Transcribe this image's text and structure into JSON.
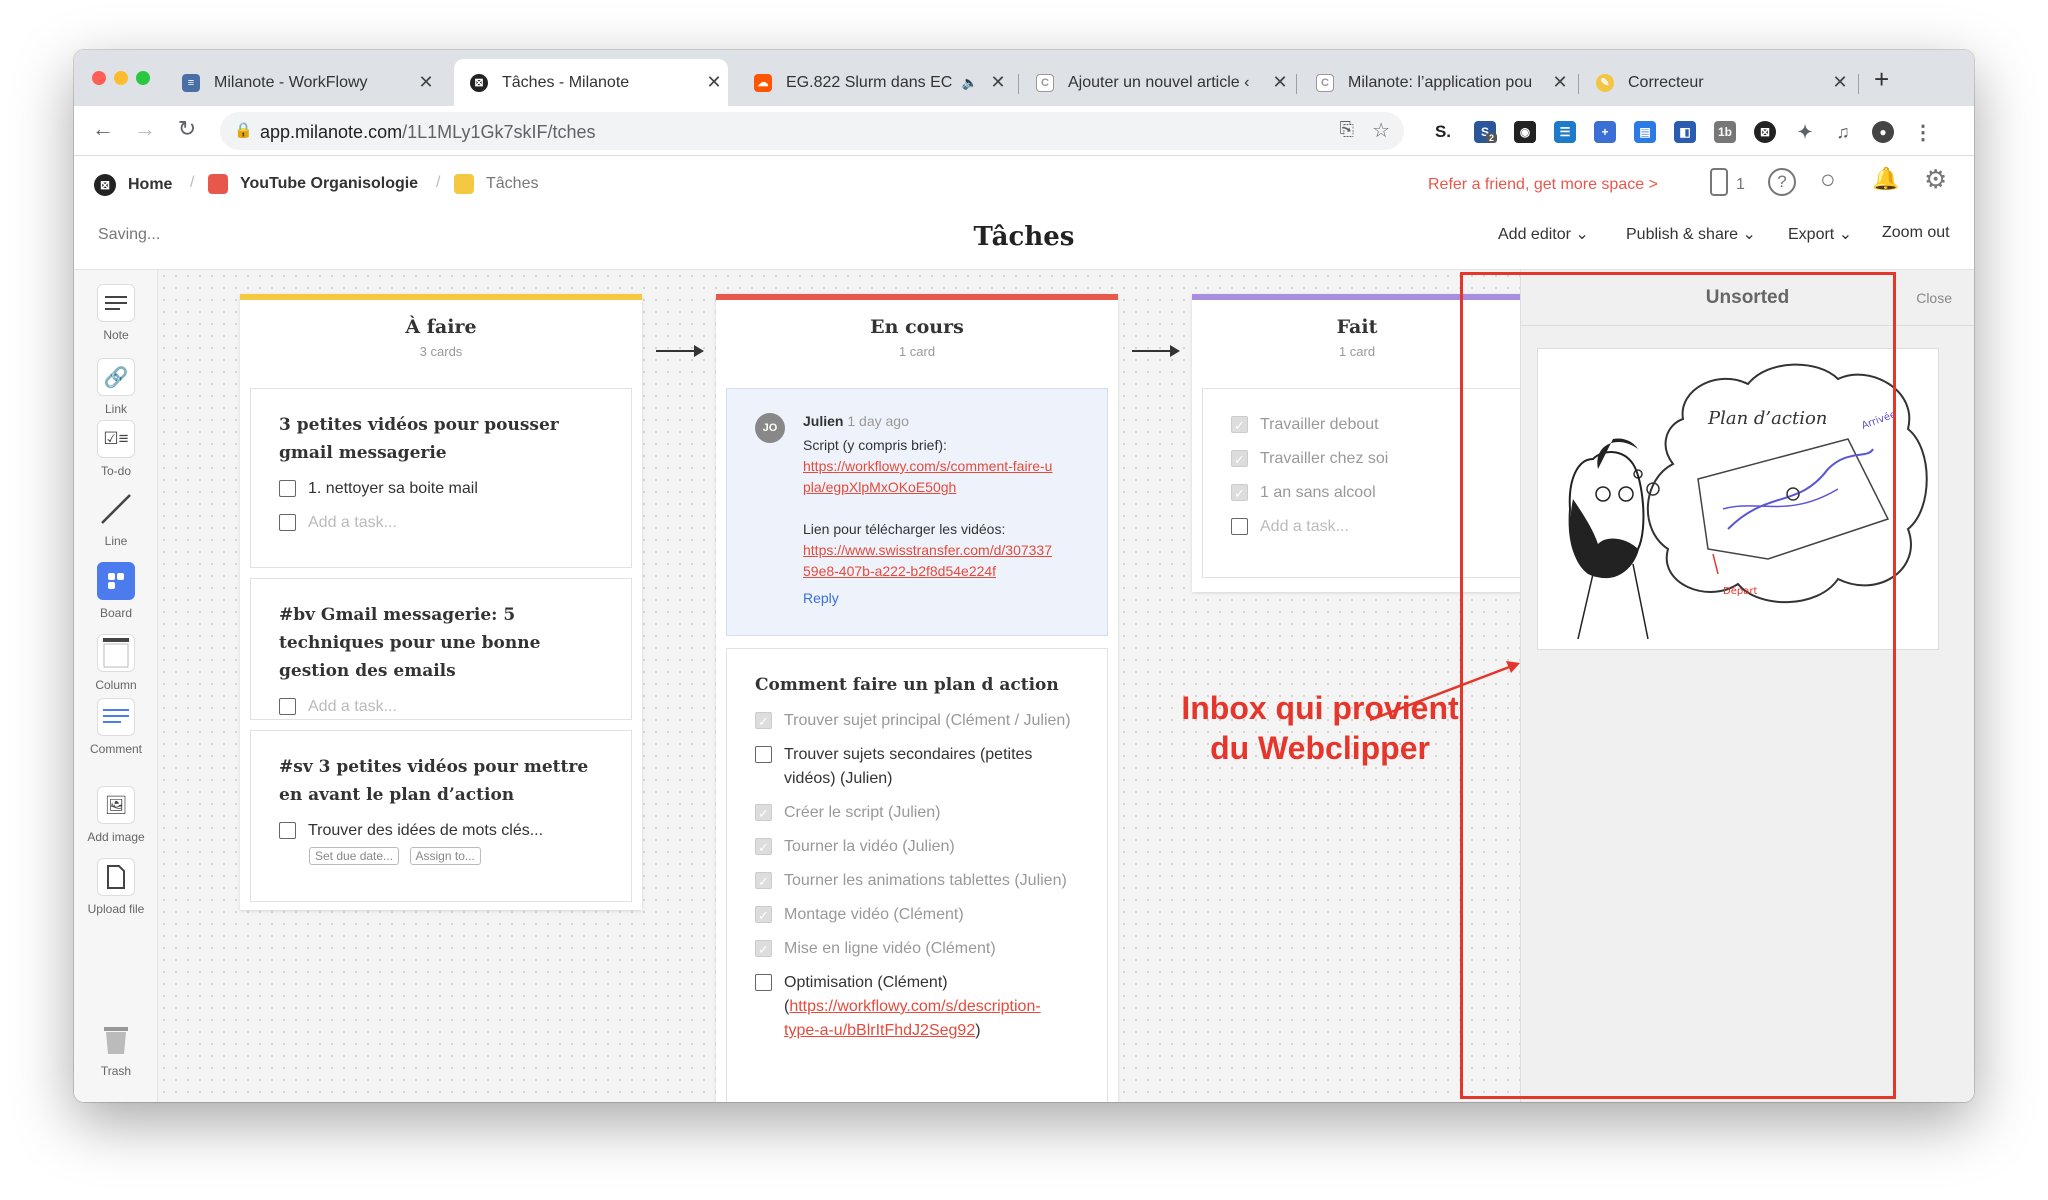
{
  "browser": {
    "tabs": [
      {
        "title": "Milanote - WorkFlowy",
        "icon": "workflowy-icon"
      },
      {
        "title": "Tâches - Milanote",
        "icon": "milanote-icon"
      },
      {
        "title": "EG.822 Slurm dans EC",
        "icon": "soundcloud-icon"
      },
      {
        "title": "Ajouter un nouvel article ‹",
        "icon": "page-icon"
      },
      {
        "title": "Milanote: l’application pou",
        "icon": "page-icon"
      },
      {
        "title": "Correcteur",
        "icon": "correcteur-icon"
      }
    ],
    "url_host": "app.milanote.com",
    "url_path": "/1L1MLy1Gk7skIF/tches",
    "new_tab": "+",
    "close": "✕",
    "ext_badge": "2"
  },
  "header": {
    "breadcrumb_home": "Home",
    "breadcrumb_board": "YouTube Organisologie",
    "breadcrumb_current": "Tâches",
    "refer": "Refer a friend, get more space >",
    "device_count": "1",
    "saving": "Saving...",
    "title": "Tâches",
    "add_editor": "Add editor",
    "publish": "Publish & share",
    "export": "Export",
    "zoom": "Zoom out"
  },
  "tools": [
    "Note",
    "Link",
    "To-do",
    "Line",
    "Board",
    "Column",
    "Comment",
    "Add image",
    "Upload file",
    "Trash"
  ],
  "columns": {
    "todo": {
      "title": "À faire",
      "count": "3 cards",
      "cards": [
        {
          "title": "3 petites vidéos pour pousser gmail messagerie",
          "task": "1. nettoyer sa boite mail",
          "add": "Add a task..."
        },
        {
          "title": "#bv Gmail messagerie: 5 techniques pour une bonne gestion des emails",
          "add": "Add a task..."
        },
        {
          "title": "#sv 3 petites vidéos pour mettre en avant le plan d’action",
          "task": "Trouver des idées de mots clés...",
          "due": "Set due date...",
          "assign": "Assign to..."
        }
      ]
    },
    "doing": {
      "title": "En cours",
      "count": "1 card",
      "comment": {
        "avatar": "JO",
        "author": "Julien",
        "time": "1 day ago",
        "line1": "Script (y compris brief):",
        "link1a": "https://workflowy.com/s/comment-faire-u",
        "link1b": "pla/egpXlpMxOKoE50gh",
        "line2": "Lien pour télécharger les vidéos:",
        "link2a": "https://www.swisstransfer.com/d/307337",
        "link2b": "59e8-407b-a222-b2f8d54e224f",
        "reply": "Reply"
      },
      "card_title": "Comment faire un plan d action",
      "tasks": [
        {
          "text": "Trouver sujet principal (Clément / Julien)",
          "done": true
        },
        {
          "text": "Trouver sujets secondaires (petites vidéos) (Julien)",
          "done": false
        },
        {
          "text": "Créer le script (Julien)",
          "done": true
        },
        {
          "text": "Tourner la vidéo (Julien)",
          "done": true
        },
        {
          "text": "Tourner les animations tablettes (Julien)",
          "done": true
        },
        {
          "text": "Montage vidéo (Clément)",
          "done": true
        },
        {
          "text": "Mise en ligne vidéo  (Clément)",
          "done": true
        }
      ],
      "last_task": "Optimisation  (Clément)",
      "last_link_a": "https://workflowy.com/s/description-",
      "last_link_b": "type-a-u/bBlrItFhdJ2Seg92",
      "last_open": "(",
      "last_close": ")"
    },
    "done": {
      "title": "Fait",
      "count": "1 card",
      "tasks": [
        {
          "text": "Travailler debout",
          "done": true
        },
        {
          "text": "Travailler chez soi",
          "done": true
        },
        {
          "text": "1 an sans alcool",
          "done": true
        }
      ],
      "add": "Add a task..."
    }
  },
  "unsorted": {
    "title": "Unsorted",
    "close": "Close",
    "sketch_heading": "Plan d’action",
    "sketch_arrivee": "Arrivée",
    "sketch_depart": "Départ"
  },
  "annotation": {
    "line1": "Inbox qui provient",
    "line2": "du Webclipper",
    "color": "#e5362c"
  },
  "colors": {
    "todo": "#f5c842",
    "doing": "#e8574c",
    "done": "#a98ee0",
    "link": "#e64a3c",
    "refer": "#e8574c"
  }
}
